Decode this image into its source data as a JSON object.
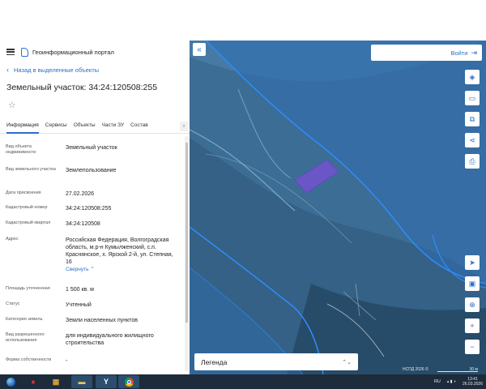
{
  "header": {
    "portal_title": "Геоинформационный портал"
  },
  "nav": {
    "back_label": "Назад в выделенные объекты"
  },
  "object": {
    "title": "Земельный участок: 34:24:120508:255"
  },
  "tabs": [
    {
      "label": "Информация",
      "active": true
    },
    {
      "label": "Сервисы",
      "active": false
    },
    {
      "label": "Объекты",
      "active": false
    },
    {
      "label": "Части ЗУ",
      "active": false
    },
    {
      "label": "Состав",
      "active": false
    }
  ],
  "properties": [
    {
      "key": "Вид объекта недвижимости",
      "value": "Земельный участок"
    },
    {
      "key": "Вид земельного участка",
      "value": "Землепользование"
    },
    {
      "key": "Дата присвоения",
      "value": "27.02.2026"
    },
    {
      "key": "Кадастровый номер",
      "value": "34:24:120508:255"
    },
    {
      "key": "Кадастровый квартал",
      "value": "34:24:120508"
    },
    {
      "key": "Адрес",
      "value": "Российская Федерация, Волгоградская область, м.р-н Кумылженский, с.п. Краснянское, х. Ярской 2-й, ул. Степная, 16",
      "action": "Свернуть"
    },
    {
      "key": "Площадь уточненная",
      "value": "1 500 кв. м"
    },
    {
      "key": "Статус",
      "value": "Учтенный"
    },
    {
      "key": "Категория земель",
      "value": "Земли населенных пунктов"
    },
    {
      "key": "Вид разрешенного использования",
      "value": "для индивидуального жилищного строительства"
    },
    {
      "key": "Форма собственности",
      "value": "-"
    }
  ],
  "map": {
    "login_label": "Войти",
    "legend_label": "Легенда",
    "copyright": "НСПД 2026 ©",
    "scale_label": "30 м",
    "tools": [
      "layers-icon",
      "ruler-icon",
      "print-area-icon",
      "share-icon",
      "print-icon"
    ],
    "nav_tools": [
      "locate-icon",
      "map-type-icon",
      "zoom-area-icon",
      "zoom-in-icon",
      "zoom-out-icon"
    ]
  },
  "taskbar": {
    "lang": "RU",
    "time": "13:41",
    "date": "26.03.2026"
  },
  "colors": {
    "accent": "#2a6fc9",
    "map_overlay": "#2f6db0",
    "parcel": "#7b4fd6",
    "taskbar": "#1d2b3a"
  }
}
